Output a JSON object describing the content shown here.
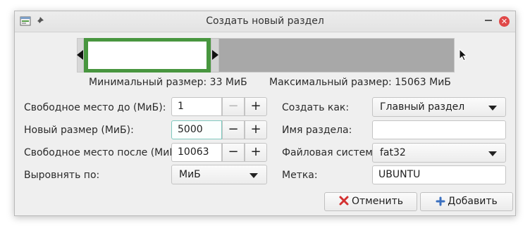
{
  "window": {
    "title": "Создать новый раздел"
  },
  "partition_bar": {
    "new_partition_fraction": 0.33
  },
  "size_info": {
    "min": "Минимальный размер: 33 МиБ",
    "max": "Максимальный размер: 15063 МиБ"
  },
  "left_form": {
    "free_before": {
      "label": "Свободное место до (МиБ):",
      "value": "1"
    },
    "new_size": {
      "label": "Новый размер (МиБ):",
      "value": "5000"
    },
    "free_after": {
      "label": "Свободное место после (МиБ):",
      "value": "10063"
    },
    "align": {
      "label": "Выровнять по:",
      "value": "МиБ"
    },
    "minus": "−",
    "plus": "+"
  },
  "right_form": {
    "create_as": {
      "label": "Создать как:",
      "value": "Главный раздел"
    },
    "partition_name": {
      "label": "Имя раздела:",
      "value": ""
    },
    "filesystem": {
      "label": "Файловая система:",
      "value": "fat32"
    },
    "label": {
      "label": "Метка:",
      "value": "UBUNTU"
    }
  },
  "buttons": {
    "cancel": "Отменить",
    "add": "Добавить"
  },
  "icons": {
    "app": "window-icon",
    "pin": "pin-icon",
    "minimize": "minimize-icon",
    "close": "close-icon",
    "cancel": "red-x-icon",
    "add": "blue-plus-icon"
  },
  "colors": {
    "new_partition": "#48963f",
    "unallocated": "#a8a8a8",
    "close_button": "#e04848",
    "focus_border": "#7fc9bf"
  }
}
